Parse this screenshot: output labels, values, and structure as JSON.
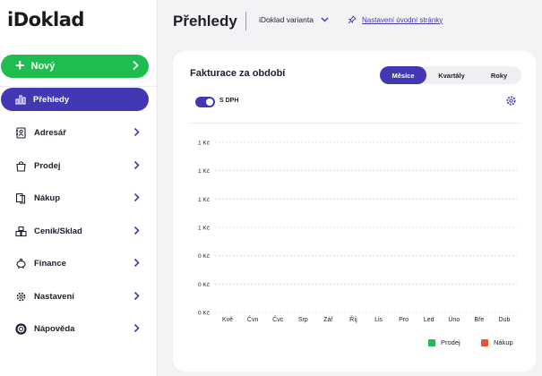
{
  "app": {
    "logo": "iDoklad"
  },
  "sidebar": {
    "new_button": "Nový",
    "items": [
      {
        "label": "Přehledy",
        "icon": "chart-bars-icon",
        "active": true
      },
      {
        "label": "Adresář",
        "icon": "address-book-icon"
      },
      {
        "label": "Prodej",
        "icon": "shopping-bag-icon"
      },
      {
        "label": "Nákup",
        "icon": "documents-icon"
      },
      {
        "label": "Ceník/Sklad",
        "icon": "warehouse-icon"
      },
      {
        "label": "Finance",
        "icon": "piggy-bank-icon"
      },
      {
        "label": "Nastavení",
        "icon": "gear-icon"
      },
      {
        "label": "Nápověda",
        "icon": "lifebuoy-icon"
      }
    ]
  },
  "header": {
    "title": "Přehledy",
    "variant": "iDoklad varianta",
    "settings_link": "Nastavení úvodní stránky"
  },
  "card": {
    "title": "Fakturace za období",
    "period_tabs": [
      "Měsíce",
      "Kvartály",
      "Roky"
    ],
    "active_tab": "Měsíce",
    "vat_toggle_label": "S DPH",
    "vat_toggle_on": true
  },
  "chart_data": {
    "type": "bar",
    "categories": [
      "Kvě",
      "Čvn",
      "Čvc",
      "Srp",
      "Zář",
      "Říj",
      "Lis",
      "Pro",
      "Led",
      "Úno",
      "Bře",
      "Dub"
    ],
    "y_tick_labels": [
      "1 Kč",
      "1 Kč",
      "1 Kč",
      "1 Kč",
      "0 Kč",
      "0 Kč",
      "0 Kč"
    ],
    "series": [
      {
        "name": "Prodej",
        "color": "#1fbd4f",
        "values": [
          0,
          0,
          0,
          0,
          0,
          0,
          0,
          0,
          0,
          0,
          0,
          0
        ]
      },
      {
        "name": "Nákup",
        "color": "#f0502d",
        "values": [
          0,
          0,
          0,
          0,
          0,
          0,
          0,
          0,
          0,
          0,
          0,
          0
        ]
      }
    ],
    "grid": true,
    "legend": "bottom-right"
  },
  "colors": {
    "primary": "#4238b4",
    "green": "#1fbd4f",
    "red": "#f0502d"
  }
}
